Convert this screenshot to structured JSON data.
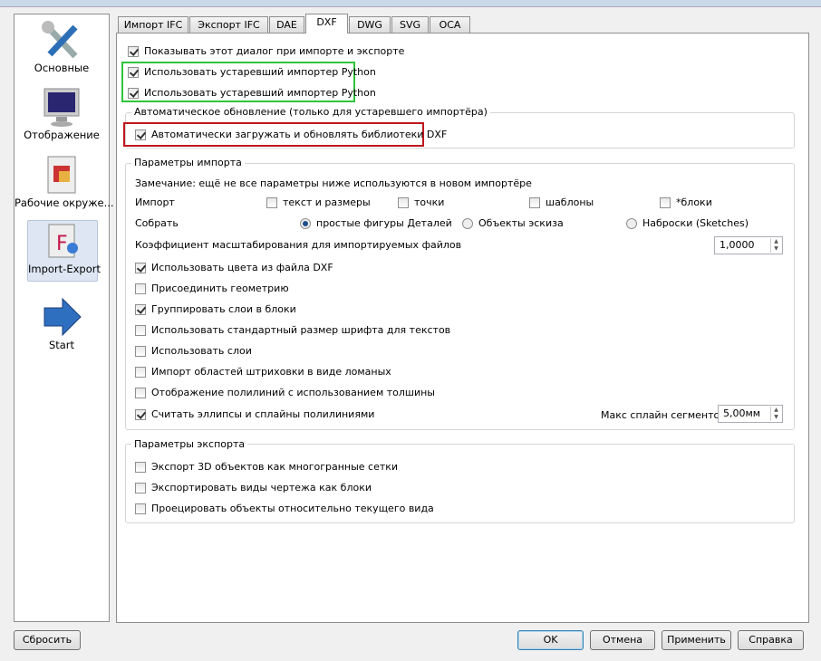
{
  "sidebar": {
    "items": [
      {
        "label": "Основные",
        "icon": "tools-icon"
      },
      {
        "label": "Отображение",
        "icon": "monitor-icon"
      },
      {
        "label": "Рабочие окруже...",
        "icon": "workbench-icon"
      },
      {
        "label": "Import-Export",
        "icon": "import-export-icon",
        "selected": true
      },
      {
        "label": "Start",
        "icon": "arrow-right-icon"
      }
    ]
  },
  "tabs": [
    "Импорт IFC",
    "Экспорт IFC",
    "DAE",
    "DXF",
    "DWG",
    "SVG",
    "OCA"
  ],
  "active_tab": "DXF",
  "top": {
    "show_dialog": {
      "label": "Показывать этот диалог при импорте и экспорте",
      "checked": true
    },
    "legacy1": {
      "label": "Использовать устаревший импортер Python",
      "checked": true
    },
    "legacy2": {
      "label": "Использовать устаревший импортер Python",
      "checked": true
    }
  },
  "autoupdate": {
    "title": "Автоматическое обновление (только для устаревшего импортёра)",
    "auto_download": {
      "label": "Автоматически загружать и обновлять библиотеки DXF",
      "checked": true
    }
  },
  "import": {
    "title": "Параметры импорта",
    "note": "Замечание: ещё не все параметры ниже используются в новом импортёре",
    "import_label": "Импорт",
    "import_opts": [
      {
        "label": "текст и размеры",
        "checked": false
      },
      {
        "label": "точки",
        "checked": false
      },
      {
        "label": "шаблоны",
        "checked": false
      },
      {
        "label": "*блоки",
        "checked": false
      }
    ],
    "join_label": "Собрать",
    "join_opts": [
      {
        "label": "простые фигуры Деталей",
        "selected": true
      },
      {
        "label": "Объекты эскиза",
        "selected": false
      },
      {
        "label": "Наброски (Sketches)",
        "selected": false
      }
    ],
    "scale_label": "Коэффициент масштабирования для импортируемых файлов",
    "scale_value": "1,0000",
    "options": [
      {
        "label": "Использовать цвета из файла DXF",
        "checked": true
      },
      {
        "label": "Присоединить геометрию",
        "checked": false
      },
      {
        "label": "Группировать слои в блоки",
        "checked": true
      },
      {
        "label": "Использовать стандартный размер шрифта для текстов",
        "checked": false
      },
      {
        "label": "Использовать слои",
        "checked": false
      },
      {
        "label": "Импорт областей штриховки в виде ломаных",
        "checked": false
      },
      {
        "label": "Отображение полилиний с использованием толшины",
        "checked": false
      },
      {
        "label": "Считать эллипсы и сплайны полилиниями",
        "checked": true
      }
    ],
    "max_spline_label": "Макс сплайн сегментов:",
    "max_spline_value": "5,00мм"
  },
  "export": {
    "title": "Параметры экспорта",
    "options": [
      {
        "label": "Экспорт 3D объектов как многогранные сетки",
        "checked": false
      },
      {
        "label": "Экспортировать виды чертежа как блоки",
        "checked": false
      },
      {
        "label": "Проецировать объекты относительно текущего вида",
        "checked": false
      }
    ]
  },
  "buttons": {
    "reset": "Сбросить",
    "ok": "OK",
    "cancel": "Отмена",
    "apply": "Применить",
    "help": "Справка"
  },
  "colors": {
    "highlight_green": "#2fc43a",
    "highlight_red": "#c0161c"
  }
}
